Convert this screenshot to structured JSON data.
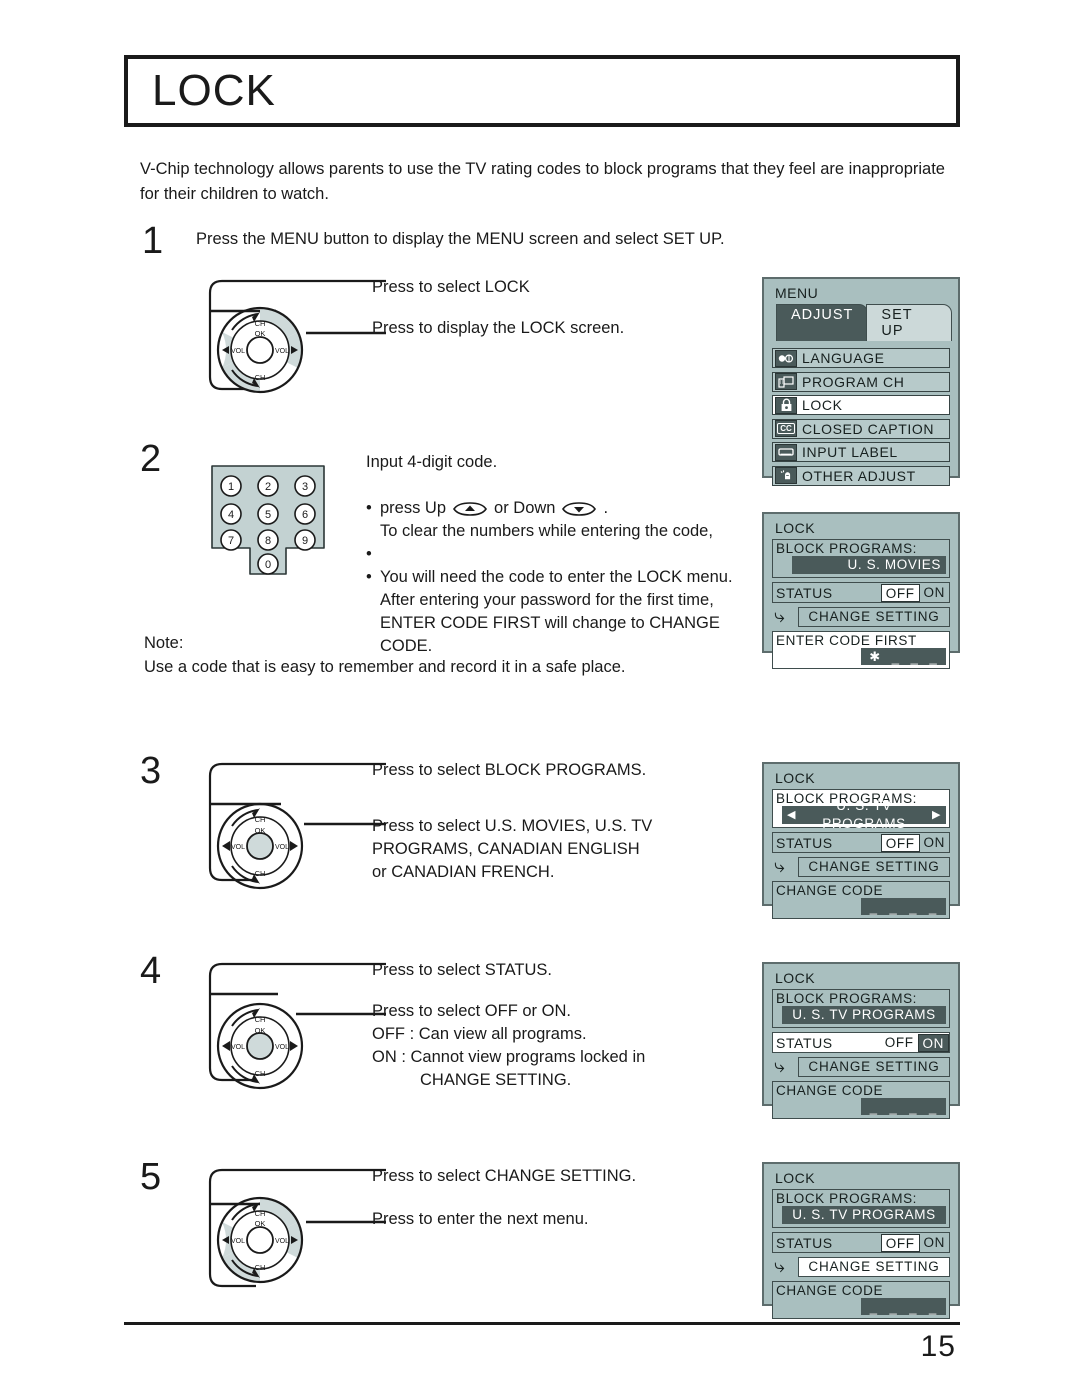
{
  "page": {
    "title": "LOCK",
    "intro": "V-Chip technology allows parents to use the TV rating codes to block programs that they feel are inappropriate for their children to watch.",
    "page_number": "15",
    "note_label": "Note:",
    "note_text": "Use a code that is easy to remember and record it in a safe place."
  },
  "steps": {
    "s1": {
      "number": "1",
      "heading": "Press the MENU button to display the MENU screen and select SET UP.",
      "callout_top": "Press to select LOCK",
      "callout_bottom": "Press to display the LOCK screen."
    },
    "s2": {
      "number": "2",
      "lead": "Input 4-digit code.",
      "bullet1a": "To clear the numbers while entering the code,",
      "bullet1b": "press Up",
      "bullet1c": "or Down",
      "bullet1d": ".",
      "bullet2": "You will need the code to enter the LOCK menu.",
      "bullet3": "After entering your password for the first time, ENTER CODE FIRST will change to CHANGE CODE."
    },
    "s3": {
      "number": "3",
      "callout_top": "Press to select BLOCK PROGRAMS.",
      "callout_bottom": "Press to select U.S. MOVIES, U.S. TV\nPROGRAMS, CANADIAN ENGLISH\nor CANADIAN FRENCH."
    },
    "s4": {
      "number": "4",
      "callout_top": "Press to select STATUS.",
      "callout_bottom_l1": "Press to select OFF or ON.",
      "callout_bottom_l2": "OFF : Can view all programs.",
      "callout_bottom_l3": "ON  : Cannot view programs locked in",
      "callout_bottom_l4": "CHANGE SETTING."
    },
    "s5": {
      "number": "5",
      "callout_top": "Press to select CHANGE SETTING.",
      "callout_bottom": "Press to enter the next menu."
    }
  },
  "wheel": {
    "ch_top": "CH",
    "ch_bottom": "CH",
    "ok": "OK",
    "vol_left": "VOL",
    "vol_right": "VOL"
  },
  "keypad": {
    "keys": [
      "1",
      "2",
      "3",
      "4",
      "5",
      "6",
      "7",
      "8",
      "9",
      "0"
    ]
  },
  "osd_menu": {
    "title": "MENU",
    "tabs": [
      {
        "label": "ADJUST",
        "state": "active"
      },
      {
        "label": "SET UP",
        "state": "inactive"
      }
    ],
    "items": [
      {
        "label": "LANGUAGE",
        "icon": "language-icon",
        "selected": false
      },
      {
        "label": "PROGRAM  CH",
        "icon": "program-ch-icon",
        "selected": false
      },
      {
        "label": "LOCK",
        "icon": "lock-padlock-icon",
        "selected": true
      },
      {
        "label": "CLOSED  CAPTION",
        "icon": "closed-caption-icon",
        "selected": false
      },
      {
        "label": "INPUT  LABEL",
        "icon": "input-label-icon",
        "selected": false
      },
      {
        "label": "OTHER  ADJUST",
        "icon": "other-adjust-icon",
        "selected": false
      }
    ]
  },
  "osd_lock_2": {
    "title": "LOCK",
    "block_programs_label": "BLOCK  PROGRAMS:",
    "block_programs_value": "U. S.   MOVIES",
    "status_label": "STATUS",
    "status_off": "OFF",
    "status_on": "ON",
    "change_setting_label": "CHANGE  SETTING",
    "code_label": "ENTER  CODE  FIRST",
    "code_digits": [
      "✱",
      "_",
      "_",
      "_"
    ]
  },
  "osd_lock_3": {
    "title": "LOCK",
    "block_programs_label": "BLOCK  PROGRAMS:",
    "block_programs_value": "U. S.  TV PROGRAMS",
    "arrow_left": "◀",
    "arrow_right": "▶",
    "status_label": "STATUS",
    "status_off": "OFF",
    "status_on": "ON",
    "change_setting_label": "CHANGE  SETTING",
    "code_label": "CHANGE CODE",
    "code_digits": [
      "_",
      "_",
      "_",
      "_"
    ]
  },
  "osd_lock_4": {
    "title": "LOCK",
    "block_programs_label": "BLOCK  PROGRAMS:",
    "block_programs_value": "U. S. TV PROGRAMS",
    "status_label": "STATUS",
    "status_off": "OFF",
    "status_on": "ON",
    "change_setting_label": "CHANGE  SETTING",
    "code_label": "CHANGE CODE",
    "code_digits": [
      "_",
      "_",
      "_",
      "_"
    ]
  },
  "osd_lock_5": {
    "title": "LOCK",
    "block_programs_label": "BLOCK  PROGRAMS:",
    "block_programs_value": "U. S. TV PROGRAMS",
    "status_label": "STATUS",
    "status_off": "OFF",
    "status_on": "ON",
    "change_setting_label": "CHANGE  SETTING",
    "code_label": "CHANGE CODE",
    "code_digits": [
      "_",
      "_",
      "_",
      "_"
    ]
  },
  "colors": {
    "osd_background": "#a9bfbf",
    "osd_highlight": "#4a5a5a",
    "osd_selected": "#ffffff",
    "ink": "#1a1a1a",
    "keypad_fill": "#c3d2d2"
  }
}
